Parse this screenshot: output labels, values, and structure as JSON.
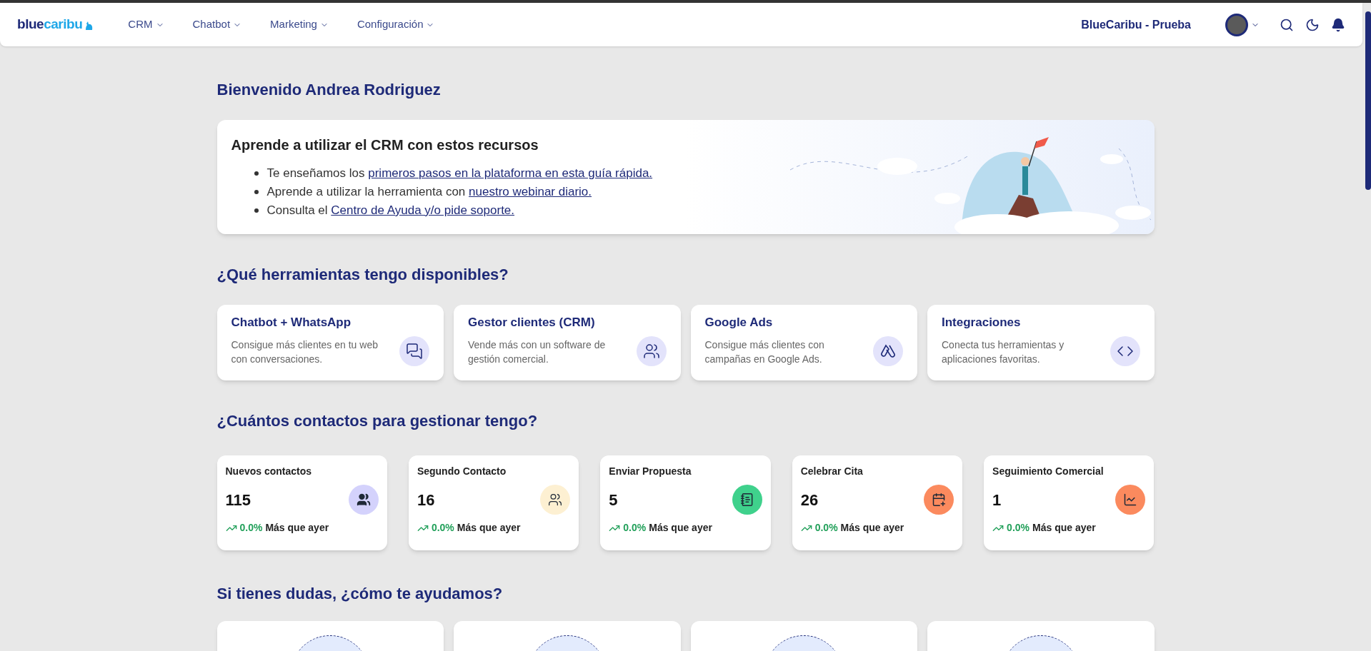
{
  "logo": {
    "part1": "blue",
    "part2": "caribu"
  },
  "nav": [
    {
      "label": "CRM"
    },
    {
      "label": "Chatbot"
    },
    {
      "label": "Marketing"
    },
    {
      "label": "Configuración"
    }
  ],
  "account": "BlueCaribu - Prueba",
  "welcome": "Bienvenido Andrea Rodriguez",
  "resources": {
    "title": "Aprende a utilizar el CRM con estos recursos",
    "items": [
      {
        "text": "Te enseñamos los ",
        "link": "primeros pasos en la plataforma en esta guía rápida."
      },
      {
        "text": "Aprende a utilizar la herramienta con ",
        "link": "nuestro webinar diario."
      },
      {
        "text": "Consulta el ",
        "link": "Centro de Ayuda y/o pide soporte."
      }
    ]
  },
  "tools": {
    "heading": "¿Qué herramientas tengo disponibles?",
    "items": [
      {
        "kind": "chat",
        "title": "Chatbot + WhatsApp",
        "description": "Consigue más clientes en tu web con conversaciones."
      },
      {
        "kind": "crm",
        "title": "Gestor clientes (CRM)",
        "description": "Vende más con un software de gestión comercial."
      },
      {
        "kind": "ads",
        "title": "Google Ads",
        "description": "Consigue más clientes con campañas en Google Ads."
      },
      {
        "kind": "code",
        "title": "Integraciones",
        "description": "Conecta tus herramientas y aplicaciones favoritas."
      }
    ]
  },
  "contacts": {
    "heading": "¿Cuántos contactos para gestionar tengo?",
    "items": [
      {
        "kind": "users",
        "title": "Nuevos contactos",
        "count": "115",
        "change": "0.0%",
        "note": "Más que ayer",
        "color": "#d4d2fc"
      },
      {
        "kind": "group",
        "title": "Segundo Contacto",
        "count": "16",
        "change": "0.0%",
        "note": "Más que ayer",
        "color": "#fdf0d2"
      },
      {
        "kind": "notebook",
        "title": "Enviar Propuesta",
        "count": "5",
        "change": "0.0%",
        "note": "Más que ayer",
        "color": "#3fd18c"
      },
      {
        "kind": "calendar",
        "title": "Celebrar Cita",
        "count": "26",
        "change": "0.0%",
        "note": "Más que ayer",
        "color": "#fb8a5e"
      },
      {
        "kind": "chart",
        "title": "Seguimiento Comercial",
        "count": "1",
        "change": "0.0%",
        "note": "Más que ayer",
        "color": "#fb8a5e"
      }
    ]
  },
  "help": {
    "heading": "Si tienes dudas, ¿cómo te ayudamos?",
    "cards": [
      {
        "kind": "circle"
      },
      {
        "kind": "circle"
      },
      {
        "kind": "circle"
      },
      {
        "kind": "circle"
      }
    ]
  }
}
